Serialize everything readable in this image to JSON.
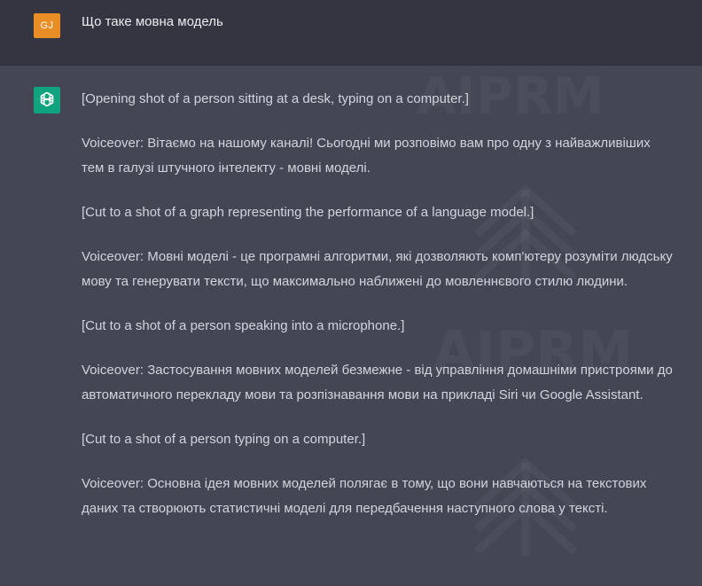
{
  "user": {
    "avatar_initials": "GJ",
    "avatar_color": "#e88e24",
    "prompt": "Що таке мовна модель"
  },
  "assistant": {
    "avatar_icon": "openai-logo-icon",
    "avatar_color": "#10a37f",
    "messages": [
      "[Opening shot of a person sitting at a desk, typing on a computer.]",
      "Voiceover: Вітаємо на нашому каналі! Сьогодні ми розповімо вам про одну з найважливіших тем в галузі штучного інтелекту - мовні моделі.",
      "[Cut to a shot of a graph representing the performance of a language model.]",
      "Voiceover: Мовні моделі - це програмні алгоритми, які дозволяють комп'ютеру розуміти людську мову та генерувати тексти, що максимально наближені до мовленнєвого стилю людини.",
      "[Cut to a shot of a person speaking into a microphone.]",
      "Voiceover: Застосування мовних моделей безмежне - від управління домашніми пристроями до автоматичного перекладу мови та розпізнавання мови на прикладі Siri чи Google Assistant.",
      "[Cut to a shot of a person typing on a computer.]",
      "Voiceover: Основна ідея мовних моделей полягає в тому, що вони навчаються на текстових даних та створюють статистичні моделі для передбачення наступного слова у тексті."
    ]
  },
  "watermark": {
    "text": "AIPRM",
    "icon": "aiprm-logo-icon"
  },
  "colors": {
    "user_bg": "#343541",
    "assistant_bg": "#444654",
    "text": "#d1d5db"
  }
}
